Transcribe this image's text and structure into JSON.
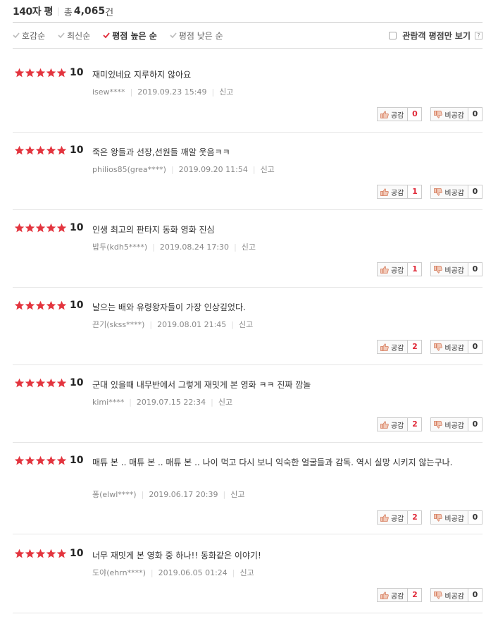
{
  "header": {
    "title": "140자 평",
    "total_prefix": "총",
    "total_count": "4,065",
    "total_suffix": "건"
  },
  "sort": {
    "options": [
      {
        "label": "호감순",
        "active": false
      },
      {
        "label": "최신순",
        "active": false
      },
      {
        "label": "평점 높은 순",
        "active": true
      },
      {
        "label": "평점 낮은 순",
        "active": false
      }
    ],
    "viewer_only_label": "관람객 평점만 보기",
    "help_label": "?"
  },
  "colors": {
    "star": "#e3343e",
    "check_active": "#e02b3a",
    "check_inactive": "#bbbbbb"
  },
  "labels": {
    "like": "공감",
    "dislike": "비공감",
    "report": "신고"
  },
  "reviews": [
    {
      "score": "10",
      "stars": 5,
      "text": "재미있네요 지루하지 않아요",
      "author": "isew****",
      "date": "2019.09.23 15:49",
      "likes": "0",
      "dislikes": "0"
    },
    {
      "score": "10",
      "stars": 5,
      "text": "죽은 왕들과 선장,선원들 깨알 웃음ㅋㅋ",
      "author": "philios85(grea****)",
      "date": "2019.09.20 11:54",
      "likes": "1",
      "dislikes": "0"
    },
    {
      "score": "10",
      "stars": 5,
      "text": "인생 최고의 판타지 동화 영화 진심",
      "author": "밥두(kdh5****)",
      "date": "2019.08.24 17:30",
      "likes": "1",
      "dislikes": "0"
    },
    {
      "score": "10",
      "stars": 5,
      "text": "날으는 배와 유령왕자들이 가장 인상깊었다.",
      "author": "끈기(skss****)",
      "date": "2019.08.01 21:45",
      "likes": "2",
      "dislikes": "0"
    },
    {
      "score": "10",
      "stars": 5,
      "text": "군대 있을때 내무반에서 그렇게 재밋게 본 영화 ㅋㅋ 진짜 깜놀",
      "author": "kimi****",
      "date": "2019.07.15 22:34",
      "likes": "2",
      "dislikes": "0"
    },
    {
      "score": "10",
      "stars": 5,
      "text": "매튜 본 .. 매튜 본 .. 매튜 본 .. 나이 먹고 다시 보니 익숙한 얼굴들과 감독. 역시 실망 시키지 않는구나.",
      "author": "퐁(elwl****)",
      "date": "2019.06.17 20:39",
      "likes": "2",
      "dislikes": "0"
    },
    {
      "score": "10",
      "stars": 5,
      "text": "너무 재밋게 본 영화 중 하나!! 동화같은 이야기!",
      "author": "도야(ehrn****)",
      "date": "2019.06.05 01:24",
      "likes": "2",
      "dislikes": "0"
    }
  ]
}
